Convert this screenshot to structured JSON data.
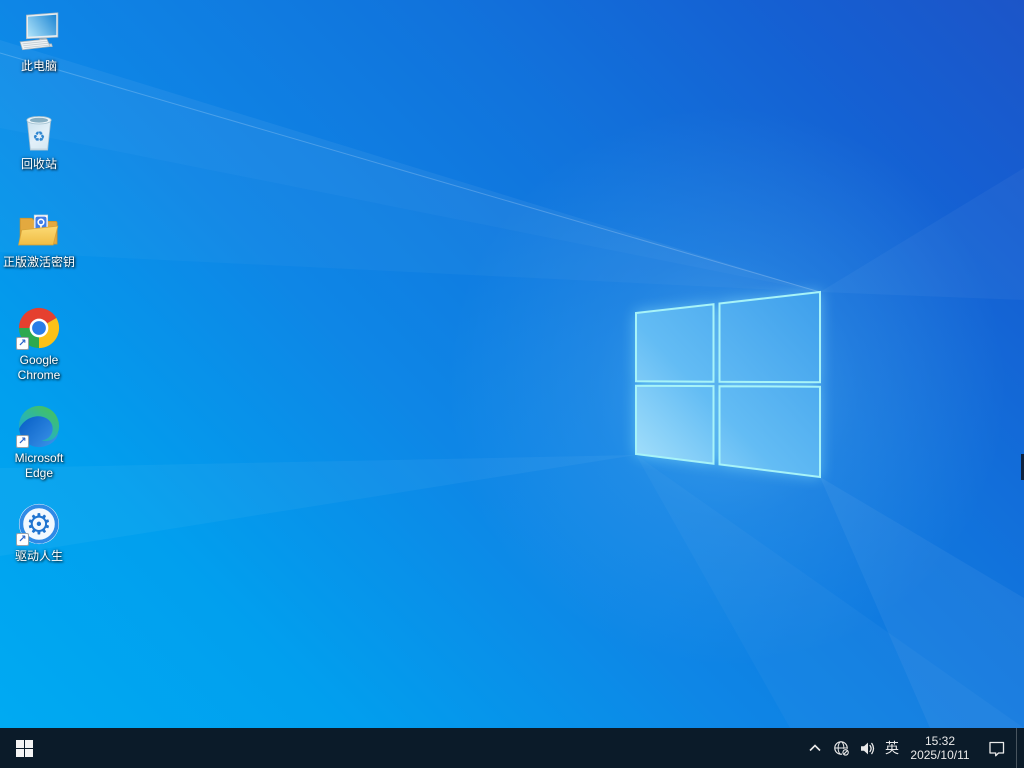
{
  "desktop_icons": [
    {
      "label": "此电脑"
    },
    {
      "label": "回收站"
    },
    {
      "label": "正版激活密钥"
    },
    {
      "label": "Google Chrome"
    },
    {
      "label": "Microsoft Edge"
    },
    {
      "label": "驱动人生"
    }
  ],
  "shortcut_arrow_glyph": "↗",
  "recycle_glyph": "♻",
  "gear_glyph": "⚙",
  "taskbar": {
    "language_indicator": "英",
    "clock": {
      "time": "15:32",
      "date": "2025/10/11"
    }
  },
  "colors": {
    "wallpaper_top_right": "#1c55c8",
    "wallpaper_bottom_left": "#00aaf2",
    "logo_pane_edge": "#a7f3f8",
    "taskbar_bg": "#0b1b29"
  }
}
